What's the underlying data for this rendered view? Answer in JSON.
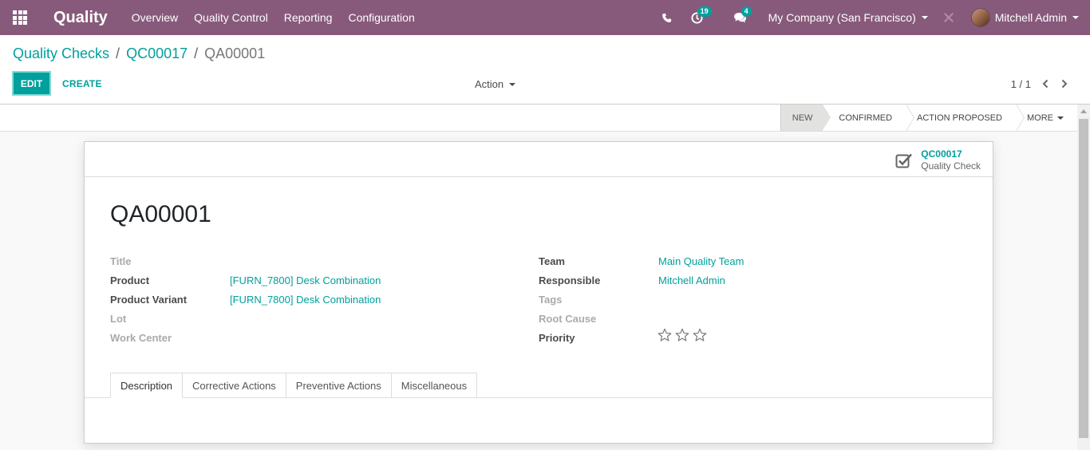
{
  "navbar": {
    "app_title": "Quality",
    "menu": [
      "Overview",
      "Quality Control",
      "Reporting",
      "Configuration"
    ],
    "activity_count": "19",
    "message_count": "4",
    "company": "My Company (San Francisco)",
    "user": "Mitchell Admin",
    "bg_color": "#875a7b"
  },
  "breadcrumb": {
    "items": [
      "Quality Checks",
      "QC00017"
    ],
    "current": "QA00001"
  },
  "toolbar": {
    "edit_label": "EDIT",
    "create_label": "CREATE",
    "action_label": "Action",
    "pager": "1 / 1"
  },
  "status": {
    "stages": [
      "NEW",
      "CONFIRMED",
      "ACTION PROPOSED"
    ],
    "current": "NEW",
    "more_label": "MORE"
  },
  "smart_button": {
    "value": "QC00017",
    "label": "Quality Check"
  },
  "record": {
    "name": "QA00001",
    "left_fields": [
      {
        "label": "Title",
        "value": ""
      },
      {
        "label": "Product",
        "value": "[FURN_7800] Desk Combination"
      },
      {
        "label": "Product Variant",
        "value": "[FURN_7800] Desk Combination"
      },
      {
        "label": "Lot",
        "value": ""
      },
      {
        "label": "Work Center",
        "value": ""
      }
    ],
    "right_fields": [
      {
        "label": "Team",
        "value": "Main Quality Team"
      },
      {
        "label": "Responsible",
        "value": "Mitchell Admin"
      },
      {
        "label": "Tags",
        "value": ""
      },
      {
        "label": "Root Cause",
        "value": ""
      },
      {
        "label": "Priority",
        "value": ""
      }
    ],
    "priority_stars": 0,
    "priority_max": 3
  },
  "tabs": [
    "Description",
    "Corrective Actions",
    "Preventive Actions",
    "Miscellaneous"
  ],
  "active_tab": "Description",
  "accent_color": "#00a09d"
}
